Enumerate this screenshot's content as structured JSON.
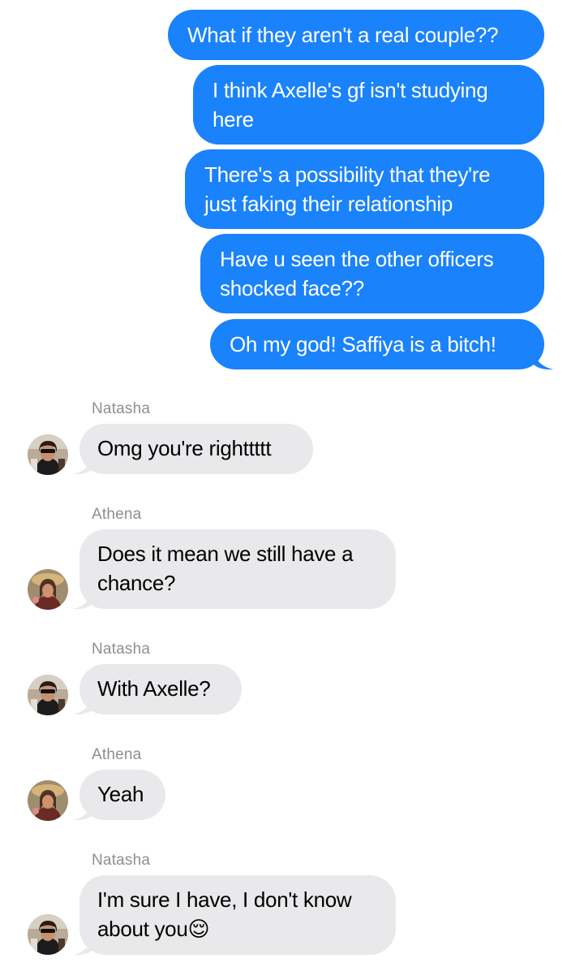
{
  "outgoing": [
    {
      "text": "What if they aren't a real couple??"
    },
    {
      "text": "I think Axelle's gf isn't studying here"
    },
    {
      "text": "There's a possibility that they're just faking their relationship"
    },
    {
      "text": "Have u seen the other officers shocked face??"
    },
    {
      "text": "Oh my god! Saffiya is a bitch!"
    }
  ],
  "incoming": [
    {
      "sender": "Natasha",
      "text": "Omg you're righttttt",
      "avatar": "natasha-avatar"
    },
    {
      "sender": "Athena",
      "text": "Does it mean we still have a chance?",
      "avatar": "athena-avatar"
    },
    {
      "sender": "Natasha",
      "text": "With Axelle?",
      "avatar": "natasha-avatar"
    },
    {
      "sender": "Athena",
      "text": "Yeah",
      "avatar": "athena-avatar"
    },
    {
      "sender": "Natasha",
      "text": "I'm sure I have, I don't know about you",
      "emoji": "😌",
      "avatar": "natasha-avatar"
    }
  ],
  "colors": {
    "outgoing_bubble": "#1a82fb",
    "incoming_bubble": "#e9e9eb",
    "sender_name": "#8e8e93"
  }
}
